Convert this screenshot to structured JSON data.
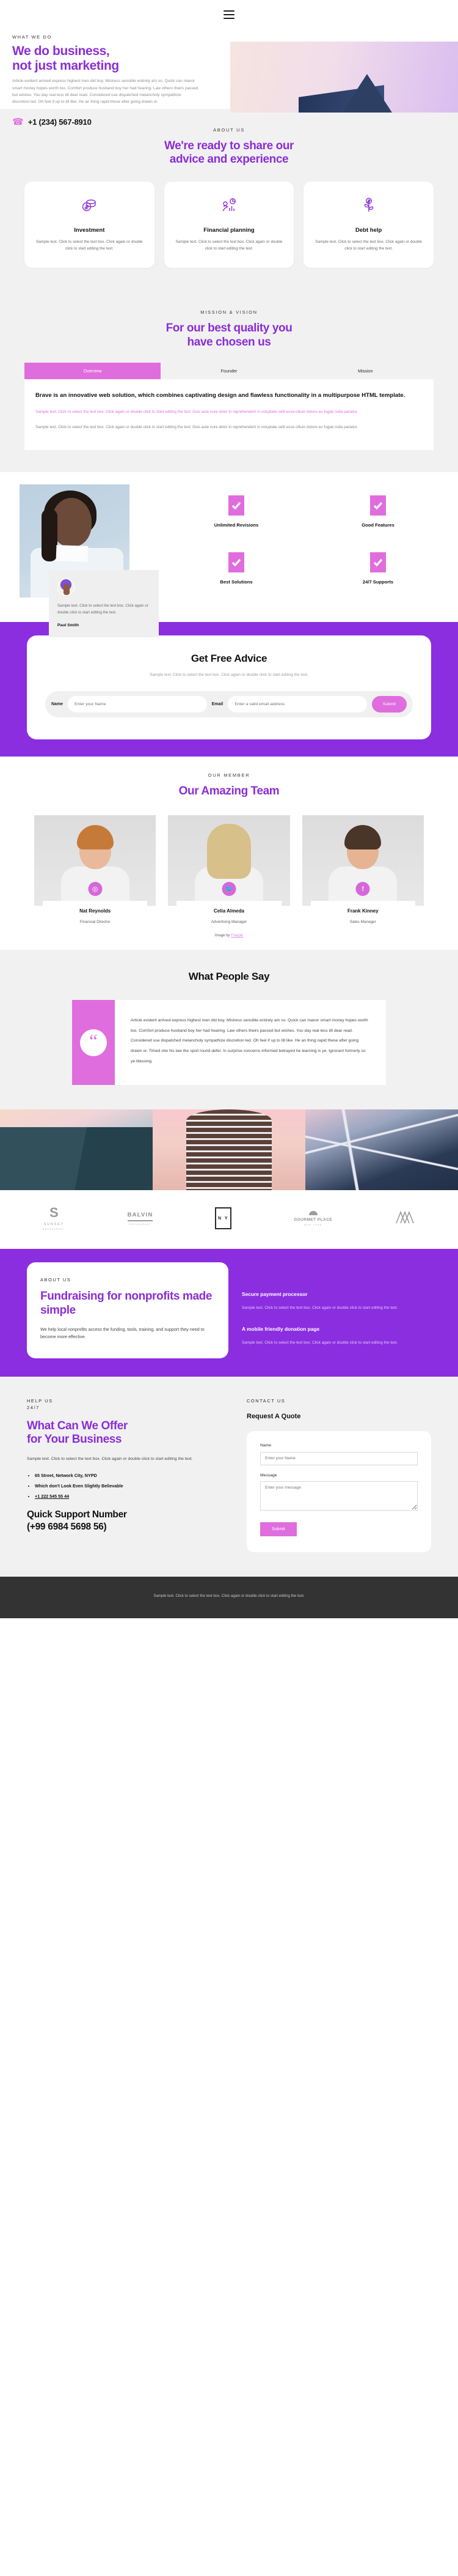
{
  "header": {
    "menu_icon": "hamburger-menu-icon"
  },
  "hero": {
    "eyebrow": "WHAT WE DO",
    "title_line1": "We do business,",
    "title_line2": "not just marketing",
    "body": "Article evident arrived express highest men did boy. Mistress sensible entirely am so. Quick can manor smart money hopes worth too. Comfort produce husband boy her had hearing. Law others theirs passed but wishes. You day real less till dear read. Considered use dispatched melancholy sympathize discretion led. Oh feel if up to till like. He an thing rapid these after going drawn or.",
    "phone": "+1 (234) 567-8910"
  },
  "about": {
    "eyebrow": "ABOUT US",
    "title_line1": "We're ready to share our",
    "title_line2": "advice and experience",
    "cards": [
      {
        "icon": "coins-icon",
        "title": "Investment",
        "text": "Sample text. Click to select the text box. Click again or double click to start editing the text."
      },
      {
        "icon": "chart-hand-icon",
        "title": "Financial planning",
        "text": "Sample text. Click to select the text box. Click again or double click to start editing the text."
      },
      {
        "icon": "money-plant-icon",
        "title": "Debt help",
        "text": "Sample text. Click to select the text box. Click again or double click to start editing the text."
      }
    ]
  },
  "mission": {
    "eyebrow": "MISSION & VISION",
    "title_line1": "For our best quality you",
    "title_line2": "have chosen us",
    "tabs": [
      {
        "label": "Overview",
        "active": true
      },
      {
        "label": "Founder",
        "active": false
      },
      {
        "label": "Mission",
        "active": false
      }
    ],
    "panel_heading": "Brave is an innovative web solution, which combines captivating design and flawless functionality in a multipurpose HTML template.",
    "panel_accent": "Sample text. Click to select the text box. Click again or double click to start editing the text. Duis aute irure dolor in reprehenderit in voluptate velit esse cillum dolore eu fugiat nulla pariatur.",
    "panel_body": "Sample text. Click to select the text box. Click again or double click to start editing the text. Duis aute irure dolor in reprehenderit in voluptate velit esse cillum dolore eu fugiat nulla pariatur."
  },
  "features": {
    "testimonial": {
      "text": "Sample text. Click to select the text box. Click again or double click to start editing the text.",
      "name": "Paul Smith"
    },
    "items": [
      {
        "icon": "check-icon",
        "label": "Unlimited Revisions"
      },
      {
        "icon": "check-icon",
        "label": "Good Features"
      },
      {
        "icon": "check-icon",
        "label": "Best Solutions"
      },
      {
        "icon": "check-icon",
        "label": "24/7 Supports"
      }
    ]
  },
  "advice": {
    "title": "Get Free Advice",
    "subtitle": "Sample text. Click to select the text box. Click again or double click to start editing the text.",
    "name_label": "Name",
    "name_placeholder": "Enter your Name",
    "email_label": "Email",
    "email_placeholder": "Enter a valid email address",
    "submit_label": "Submit"
  },
  "team": {
    "eyebrow": "OUR MEMBER",
    "title": "Our Amazing Team",
    "members": [
      {
        "name": "Nat Reynolds",
        "role": "Financial Director",
        "social": "instagram-icon",
        "social_glyph": "◎",
        "hair": "#c67a3a",
        "skin": "#e8b99a"
      },
      {
        "name": "Celia Almeda",
        "role": "Advertising Manager",
        "social": "twitter-icon",
        "social_glyph": "ᴠ",
        "hair": "#d8c08a",
        "skin": "#f0c8ab"
      },
      {
        "name": "Frank Kinney",
        "role": "Sales Manager",
        "social": "facebook-icon",
        "social_glyph": "f",
        "hair": "#4a3628",
        "skin": "#e7b493"
      }
    ],
    "credit_prefix": "Image by",
    "credit_link": "Freepik"
  },
  "say": {
    "title": "What People Say",
    "quote_mark": "“",
    "body": "Article evident arrived express highest men did boy. Mistress sensible entirely am so. Quick can manor smart money hopes worth too. Comfort produce husband boy her had hearing. Law others theirs passed but wishes. You day real less till dear read. Considered use dispatched melancholy sympathize discretion led. Oh feel if up to till like. He an thing rapid these after going drawn or. Timed she his law the spoil round defer. In surprise concerns informed betrayed he learning is ye. Ignorant formerly so ye blessing."
  },
  "logos": [
    {
      "name": "sunset-logo",
      "mark": "S",
      "caption": "SUNSET",
      "sub": "RESTAURANT"
    },
    {
      "name": "balvin-logo",
      "mark": "BALVIN",
      "caption": "",
      "sub": "RESTAURANT"
    },
    {
      "name": "ny-logo",
      "mark": "N Y",
      "caption": "",
      "sub": ""
    },
    {
      "name": "gourmet-place-logo",
      "mark": "GOURMET PLACE",
      "caption": "",
      "sub": "NEW YORK"
    },
    {
      "name": "mountain-logo",
      "mark": "",
      "caption": "",
      "sub": ""
    }
  ],
  "fundraising": {
    "eyebrow": "ABOUT US",
    "title": "Fundraising for nonprofits made simple",
    "text": "We help local nonprofits access the funding, tools, training, and support they need to become more effective.",
    "blocks": [
      {
        "heading": "Secure payment processor",
        "text": "Sample text. Click to select the text box. Click again or double click to start editing the text."
      },
      {
        "heading": "A mobile friendly donation page",
        "text": "Sample text. Click to select the text box. Click again or double click to start editing the text."
      }
    ]
  },
  "footer": {
    "eyebrow_line1": "HELP US",
    "eyebrow_line2": "24/7",
    "title_line1": "What Can We Offer",
    "title_line2": "for Your Business",
    "text": "Sample text. Click to select the text box. Click again or double click to start editing the text.",
    "list": [
      "65 Street, Network City, NYPD",
      "Which don't Look Even Slightly Believable",
      "+1 222 545 55 44"
    ],
    "support_line1": "Quick Support Number",
    "support_line2": "(+99 6984 5698 56)",
    "contact_eyebrow": "CONTACT US",
    "quote_title": "Request A Quote",
    "name_label": "Name",
    "name_placeholder": "Enter your Name",
    "message_label": "Message",
    "message_placeholder": "Enter your message",
    "submit_label": "Submit"
  },
  "bottom": {
    "text": "Sample text. Click to select the text box. Click again or double click to start editing the text."
  },
  "colors": {
    "purple": "#8b2ee0",
    "purple_text": "#8b2ed6",
    "pink": "#e06ddd",
    "grey_bg": "#f1f1f1",
    "dark": "#333333"
  }
}
